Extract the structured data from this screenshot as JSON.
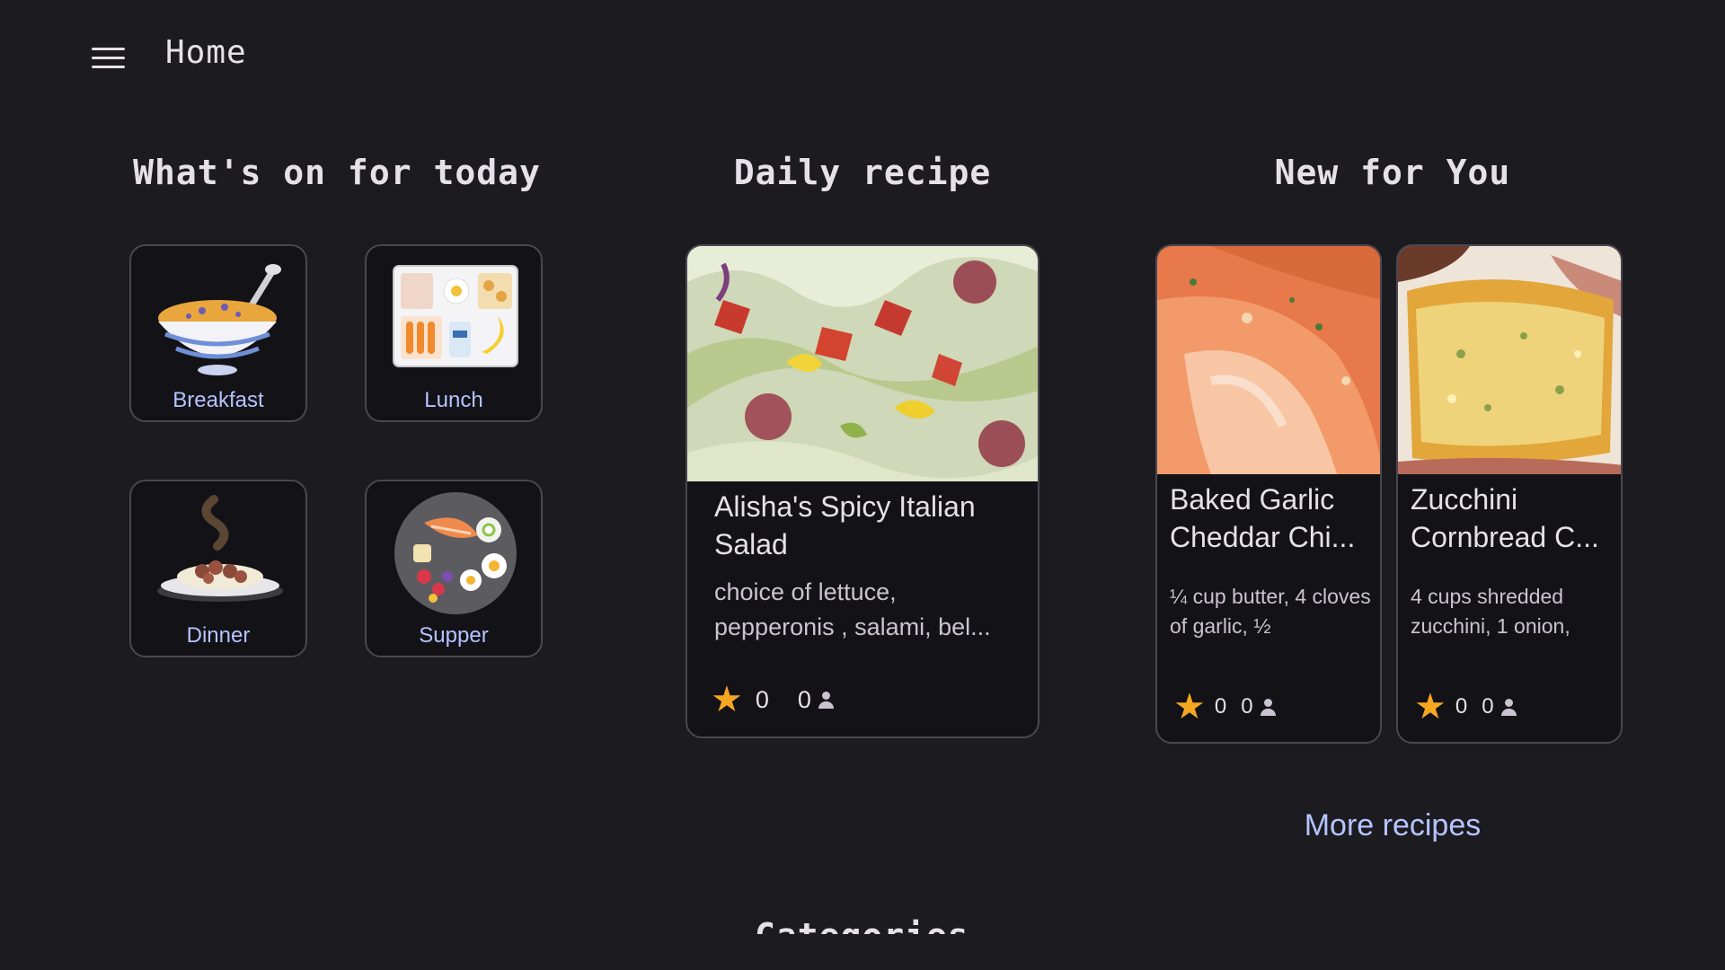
{
  "header": {
    "title": "Home",
    "menu_icon": "hamburger-menu-icon"
  },
  "sections": {
    "today": "What's on for today",
    "daily": "Daily recipe",
    "new": "New for You",
    "categories": "Categories"
  },
  "meals": [
    {
      "label": "Breakfast",
      "icon": "cereal-bowl-icon"
    },
    {
      "label": "Lunch",
      "icon": "lunch-tray-icon"
    },
    {
      "label": "Dinner",
      "icon": "pasta-plate-icon"
    },
    {
      "label": "Supper",
      "icon": "mixed-plate-icon"
    }
  ],
  "daily_recipe": {
    "title": "Alisha's Spicy Italian Salad",
    "description": "choice of lettuce, pepperonis , salami, bel...",
    "rating": "0",
    "people": "0"
  },
  "new_recipes": [
    {
      "title": "Baked Garlic Cheddar Chi...",
      "description": "¼ cup butter, 4 cloves of garlic, ½",
      "rating": "0",
      "people": "0"
    },
    {
      "title": "Zucchini Cornbread C...",
      "description": "4 cups shredded zucchini, 1 onion,",
      "rating": "0",
      "people": "0"
    }
  ],
  "more_link": "More recipes",
  "colors": {
    "background": "#1c1b20",
    "card": "#131217",
    "accent": "#b6c4ff",
    "star": "#f5a623"
  }
}
